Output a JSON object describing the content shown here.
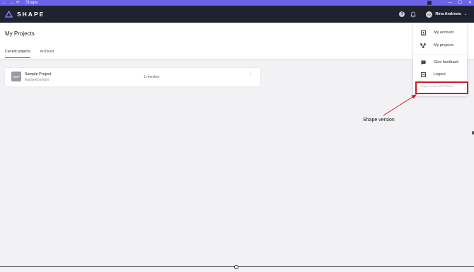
{
  "browser": {
    "back_glyph": "←",
    "forward_glyph": "→",
    "reload_glyph": "⟳",
    "tab_title": "Shape",
    "min_glyph": "—",
    "max_glyph": "☐",
    "close_glyph": "✕"
  },
  "header": {
    "logo_text": "SHAPE",
    "help_glyph": "?",
    "user_initials": "RA",
    "user_name": "Rina Andrews",
    "chevron": "⌄"
  },
  "page": {
    "title": "My Projects",
    "tabs": [
      {
        "label": "Current projects",
        "active": true
      },
      {
        "label": "Archived",
        "active": false
      }
    ]
  },
  "projects": [
    {
      "thumb": "SMP",
      "name": "Sample Project",
      "timezone": "Europe/London",
      "members": "1 member",
      "menu_glyph": "⋮"
    }
  ],
  "dropdown": {
    "items": [
      {
        "label": "My account",
        "icon": "account-icon"
      },
      {
        "label": "My projects",
        "icon": "projects-icon"
      },
      {
        "label": "Give feedback",
        "icon": "feedback-icon"
      },
      {
        "label": "Logout",
        "icon": "logout-icon"
      }
    ],
    "version": "Shape version 66707b2d3"
  },
  "annotation": {
    "label": "Shape version"
  },
  "colors": {
    "header_bg": "#1f2330",
    "chrome_bg": "#6c63e8",
    "accent": "#5b57d6",
    "highlight": "#c91d25"
  }
}
